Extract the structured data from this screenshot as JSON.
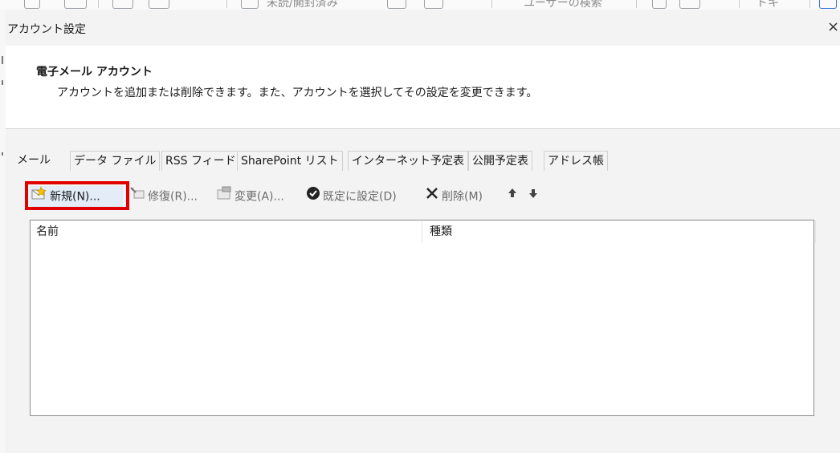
{
  "background": {
    "visible_fragment": "未読/開封済み",
    "fragment2": "ユーザーの検索",
    "fragment3": "ドキ"
  },
  "dialog": {
    "title": "アカウント設定",
    "close_glyph": "×"
  },
  "header": {
    "title": "電子メール アカウント",
    "description": "アカウントを追加または削除できます。また、アカウントを選択してその設定を変更できます。"
  },
  "tabs": [
    {
      "label": "メール",
      "active": true
    },
    {
      "label": "データ ファイル",
      "active": false
    },
    {
      "label": "RSS フィード",
      "active": false
    },
    {
      "label": "SharePoint リスト",
      "active": false
    },
    {
      "label": "インターネット予定表",
      "active": false
    },
    {
      "label": "公開予定表",
      "active": false
    },
    {
      "label": "アドレス帳",
      "active": false
    }
  ],
  "toolbar": {
    "new_label": "新規(N)...",
    "repair_label": "修復(R)...",
    "change_label": "変更(A)...",
    "default_label": "既定に設定(D)",
    "delete_label": "削除(M)",
    "icons": {
      "new": "new-mail-icon",
      "repair": "repair-icon",
      "change": "change-icon",
      "default": "checkmark-circle-icon",
      "delete": "delete-x-icon",
      "up": "arrow-up-icon",
      "down": "arrow-down-icon"
    }
  },
  "list": {
    "columns": [
      "名前",
      "種類"
    ],
    "rows": []
  },
  "colors": {
    "highlight": "#e00000",
    "dialog_bg": "#f3f3f3",
    "panel_bg": "#ffffff"
  }
}
